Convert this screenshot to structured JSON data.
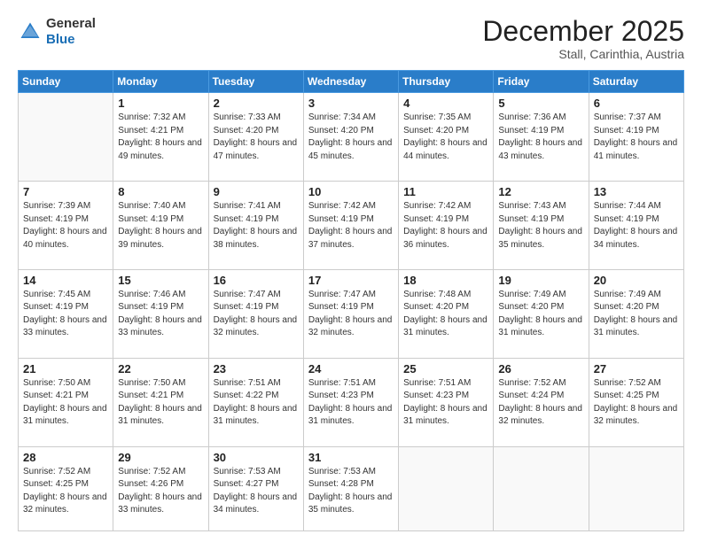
{
  "header": {
    "logo_general": "General",
    "logo_blue": "Blue",
    "month_title": "December 2025",
    "location": "Stall, Carinthia, Austria"
  },
  "weekdays": [
    "Sunday",
    "Monday",
    "Tuesday",
    "Wednesday",
    "Thursday",
    "Friday",
    "Saturday"
  ],
  "weeks": [
    [
      {
        "day": "",
        "sunrise": "",
        "sunset": "",
        "daylight": ""
      },
      {
        "day": "1",
        "sunrise": "Sunrise: 7:32 AM",
        "sunset": "Sunset: 4:21 PM",
        "daylight": "Daylight: 8 hours and 49 minutes."
      },
      {
        "day": "2",
        "sunrise": "Sunrise: 7:33 AM",
        "sunset": "Sunset: 4:20 PM",
        "daylight": "Daylight: 8 hours and 47 minutes."
      },
      {
        "day": "3",
        "sunrise": "Sunrise: 7:34 AM",
        "sunset": "Sunset: 4:20 PM",
        "daylight": "Daylight: 8 hours and 45 minutes."
      },
      {
        "day": "4",
        "sunrise": "Sunrise: 7:35 AM",
        "sunset": "Sunset: 4:20 PM",
        "daylight": "Daylight: 8 hours and 44 minutes."
      },
      {
        "day": "5",
        "sunrise": "Sunrise: 7:36 AM",
        "sunset": "Sunset: 4:19 PM",
        "daylight": "Daylight: 8 hours and 43 minutes."
      },
      {
        "day": "6",
        "sunrise": "Sunrise: 7:37 AM",
        "sunset": "Sunset: 4:19 PM",
        "daylight": "Daylight: 8 hours and 41 minutes."
      }
    ],
    [
      {
        "day": "7",
        "sunrise": "Sunrise: 7:39 AM",
        "sunset": "Sunset: 4:19 PM",
        "daylight": "Daylight: 8 hours and 40 minutes."
      },
      {
        "day": "8",
        "sunrise": "Sunrise: 7:40 AM",
        "sunset": "Sunset: 4:19 PM",
        "daylight": "Daylight: 8 hours and 39 minutes."
      },
      {
        "day": "9",
        "sunrise": "Sunrise: 7:41 AM",
        "sunset": "Sunset: 4:19 PM",
        "daylight": "Daylight: 8 hours and 38 minutes."
      },
      {
        "day": "10",
        "sunrise": "Sunrise: 7:42 AM",
        "sunset": "Sunset: 4:19 PM",
        "daylight": "Daylight: 8 hours and 37 minutes."
      },
      {
        "day": "11",
        "sunrise": "Sunrise: 7:42 AM",
        "sunset": "Sunset: 4:19 PM",
        "daylight": "Daylight: 8 hours and 36 minutes."
      },
      {
        "day": "12",
        "sunrise": "Sunrise: 7:43 AM",
        "sunset": "Sunset: 4:19 PM",
        "daylight": "Daylight: 8 hours and 35 minutes."
      },
      {
        "day": "13",
        "sunrise": "Sunrise: 7:44 AM",
        "sunset": "Sunset: 4:19 PM",
        "daylight": "Daylight: 8 hours and 34 minutes."
      }
    ],
    [
      {
        "day": "14",
        "sunrise": "Sunrise: 7:45 AM",
        "sunset": "Sunset: 4:19 PM",
        "daylight": "Daylight: 8 hours and 33 minutes."
      },
      {
        "day": "15",
        "sunrise": "Sunrise: 7:46 AM",
        "sunset": "Sunset: 4:19 PM",
        "daylight": "Daylight: 8 hours and 33 minutes."
      },
      {
        "day": "16",
        "sunrise": "Sunrise: 7:47 AM",
        "sunset": "Sunset: 4:19 PM",
        "daylight": "Daylight: 8 hours and 32 minutes."
      },
      {
        "day": "17",
        "sunrise": "Sunrise: 7:47 AM",
        "sunset": "Sunset: 4:19 PM",
        "daylight": "Daylight: 8 hours and 32 minutes."
      },
      {
        "day": "18",
        "sunrise": "Sunrise: 7:48 AM",
        "sunset": "Sunset: 4:20 PM",
        "daylight": "Daylight: 8 hours and 31 minutes."
      },
      {
        "day": "19",
        "sunrise": "Sunrise: 7:49 AM",
        "sunset": "Sunset: 4:20 PM",
        "daylight": "Daylight: 8 hours and 31 minutes."
      },
      {
        "day": "20",
        "sunrise": "Sunrise: 7:49 AM",
        "sunset": "Sunset: 4:20 PM",
        "daylight": "Daylight: 8 hours and 31 minutes."
      }
    ],
    [
      {
        "day": "21",
        "sunrise": "Sunrise: 7:50 AM",
        "sunset": "Sunset: 4:21 PM",
        "daylight": "Daylight: 8 hours and 31 minutes."
      },
      {
        "day": "22",
        "sunrise": "Sunrise: 7:50 AM",
        "sunset": "Sunset: 4:21 PM",
        "daylight": "Daylight: 8 hours and 31 minutes."
      },
      {
        "day": "23",
        "sunrise": "Sunrise: 7:51 AM",
        "sunset": "Sunset: 4:22 PM",
        "daylight": "Daylight: 8 hours and 31 minutes."
      },
      {
        "day": "24",
        "sunrise": "Sunrise: 7:51 AM",
        "sunset": "Sunset: 4:23 PM",
        "daylight": "Daylight: 8 hours and 31 minutes."
      },
      {
        "day": "25",
        "sunrise": "Sunrise: 7:51 AM",
        "sunset": "Sunset: 4:23 PM",
        "daylight": "Daylight: 8 hours and 31 minutes."
      },
      {
        "day": "26",
        "sunrise": "Sunrise: 7:52 AM",
        "sunset": "Sunset: 4:24 PM",
        "daylight": "Daylight: 8 hours and 32 minutes."
      },
      {
        "day": "27",
        "sunrise": "Sunrise: 7:52 AM",
        "sunset": "Sunset: 4:25 PM",
        "daylight": "Daylight: 8 hours and 32 minutes."
      }
    ],
    [
      {
        "day": "28",
        "sunrise": "Sunrise: 7:52 AM",
        "sunset": "Sunset: 4:25 PM",
        "daylight": "Daylight: 8 hours and 32 minutes."
      },
      {
        "day": "29",
        "sunrise": "Sunrise: 7:52 AM",
        "sunset": "Sunset: 4:26 PM",
        "daylight": "Daylight: 8 hours and 33 minutes."
      },
      {
        "day": "30",
        "sunrise": "Sunrise: 7:53 AM",
        "sunset": "Sunset: 4:27 PM",
        "daylight": "Daylight: 8 hours and 34 minutes."
      },
      {
        "day": "31",
        "sunrise": "Sunrise: 7:53 AM",
        "sunset": "Sunset: 4:28 PM",
        "daylight": "Daylight: 8 hours and 35 minutes."
      },
      {
        "day": "",
        "sunrise": "",
        "sunset": "",
        "daylight": ""
      },
      {
        "day": "",
        "sunrise": "",
        "sunset": "",
        "daylight": ""
      },
      {
        "day": "",
        "sunrise": "",
        "sunset": "",
        "daylight": ""
      }
    ]
  ]
}
